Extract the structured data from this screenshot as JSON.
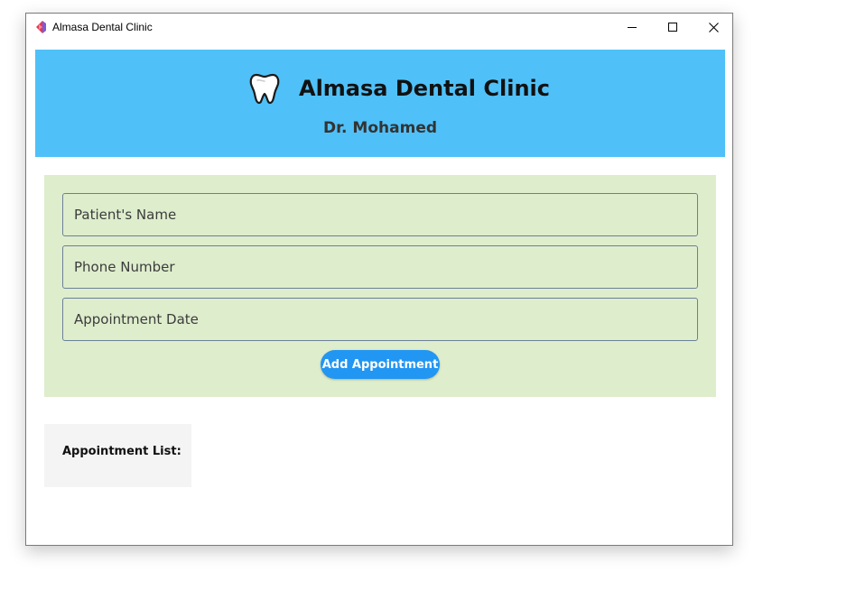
{
  "window": {
    "title": "Almasa Dental Clinic"
  },
  "header": {
    "icon": "tooth-icon",
    "title": "Almasa Dental Clinic",
    "doctor": "Dr. Mohamed",
    "background": "#4fc1f8"
  },
  "form": {
    "background": "#deedcc",
    "patient_name": {
      "value": "",
      "placeholder": "Patient's Name"
    },
    "phone_number": {
      "value": "",
      "placeholder": "Phone Number"
    },
    "appointment_date": {
      "value": "",
      "placeholder": "Appointment Date"
    },
    "submit_label": "Add Appointment",
    "submit_color": "#2196f3"
  },
  "appointments": {
    "title": "Appointment List:",
    "items": []
  }
}
